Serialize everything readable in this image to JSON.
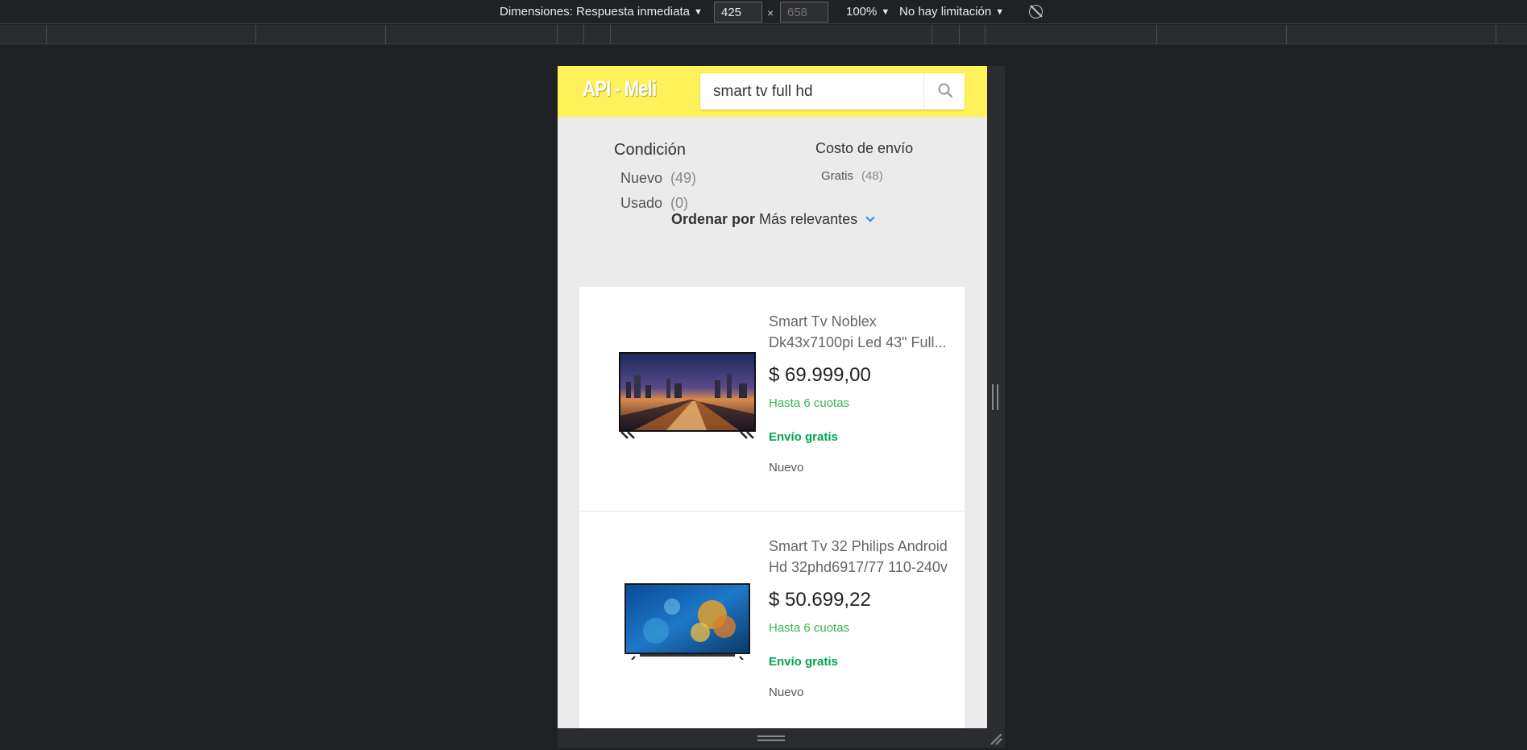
{
  "devtools": {
    "dimensions_label": "Dimensiones: Respuesta inmediata",
    "width_value": "425",
    "height_placeholder": "658",
    "times": "×",
    "zoom": "100%",
    "throttle": "No hay limitación",
    "caret": "▼",
    "rotate_icon": "rotate-icon"
  },
  "header": {
    "logo": "API - Meli",
    "bg_color": "#fff159",
    "search_value": "smart tv full hd",
    "search_icon": "search-icon"
  },
  "filters": {
    "condition": {
      "title": "Condición",
      "options": [
        {
          "label": "Nuevo",
          "count": "(49)"
        },
        {
          "label": "Usado",
          "count": "(0)"
        }
      ]
    },
    "shipping": {
      "title": "Costo de envío",
      "options": [
        {
          "label": "Gratis",
          "count": "(48)"
        }
      ]
    }
  },
  "sort": {
    "label": "Ordenar por",
    "value": "Más relevantes",
    "accent_color": "#3483fa"
  },
  "products": [
    {
      "title": "Smart Tv Noblex Dk43x7100pi Led 43\" Full...",
      "price": "$ 69.999,00",
      "installments": "Hasta 6 cuotas",
      "shipping": "Envío gratis",
      "condition": "Nuevo",
      "image": "tv-city-night-image"
    },
    {
      "title": "Smart Tv 32 Philips Android Hd 32phd6917/77 110-240v",
      "price": "$ 50.699,22",
      "installments": "Hasta 6 cuotas",
      "shipping": "Envío gratis",
      "condition": "Nuevo",
      "image": "tv-coral-image"
    }
  ]
}
